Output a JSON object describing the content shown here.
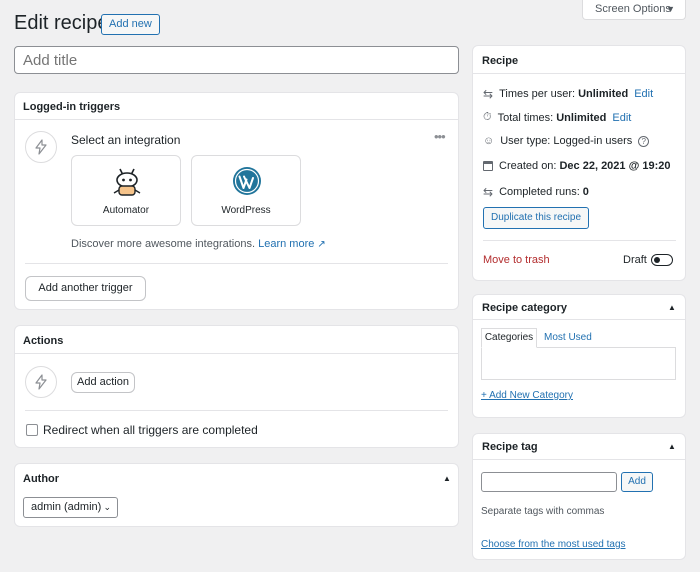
{
  "header": {
    "title": "Edit recipe",
    "add_new": "Add new",
    "screen_options": "Screen Options"
  },
  "title_input": {
    "placeholder": "Add title"
  },
  "triggers": {
    "heading": "Logged-in triggers",
    "select_integration": "Select an integration",
    "integrations": [
      {
        "name": "Automator",
        "icon": "automator-robot-icon"
      },
      {
        "name": "WordPress",
        "icon": "wordpress-logo-icon"
      }
    ],
    "discover_text": "Discover more awesome integrations.",
    "learn_more": "Learn more",
    "add_another": "Add another trigger"
  },
  "actions": {
    "heading": "Actions",
    "add_action": "Add action",
    "redirect_label": "Redirect when all triggers are completed"
  },
  "author": {
    "heading": "Author",
    "selected": "admin (admin)"
  },
  "recipe": {
    "heading": "Recipe",
    "times_per_user_label": "Times per user:",
    "times_per_user_value": "Unlimited",
    "total_times_label": "Total times:",
    "total_times_value": "Unlimited",
    "edit": "Edit",
    "user_type_label": "User type:",
    "user_type_value": "Logged-in users",
    "created_on_label": "Created on:",
    "created_on_value": "Dec 22, 2021 @ 19:20",
    "completed_runs_label": "Completed runs:",
    "completed_runs_value": "0",
    "duplicate": "Duplicate this recipe",
    "move_to_trash": "Move to trash",
    "status_label": "Draft"
  },
  "category": {
    "heading": "Recipe category",
    "tabs": [
      "Categories",
      "Most Used"
    ],
    "add_new": "+ Add New Category"
  },
  "tag": {
    "heading": "Recipe tag",
    "add": "Add",
    "hint": "Separate tags with commas",
    "choose": "Choose from the most used tags"
  },
  "colors": {
    "accent": "#2271b1",
    "trash": "#b32d2e",
    "background": "#f0f0f1"
  }
}
